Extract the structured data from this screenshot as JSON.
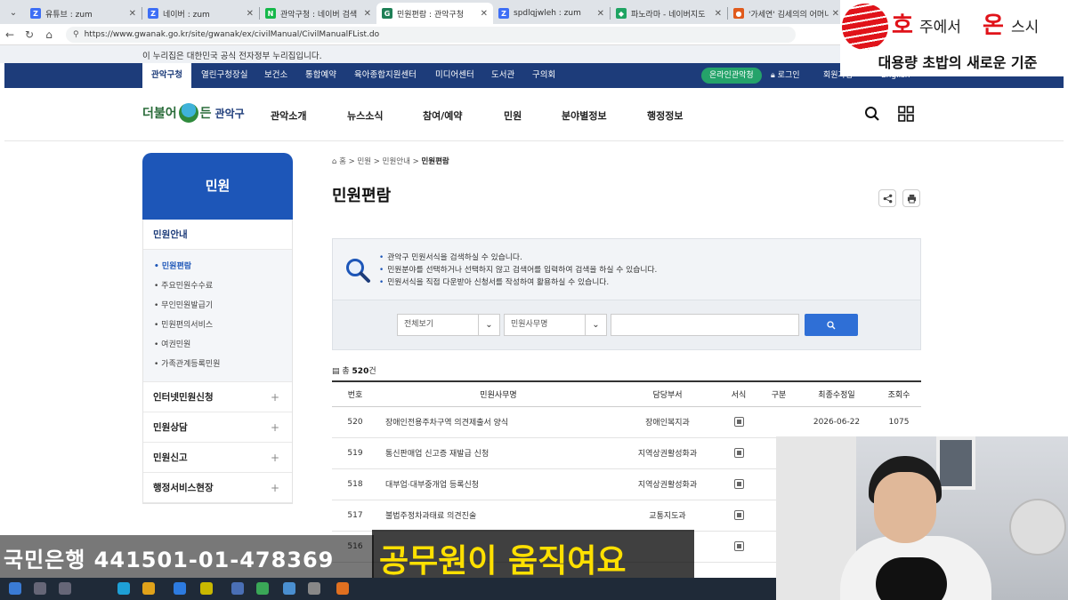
{
  "browser": {
    "tabs": [
      {
        "title": "유튜브 : zum",
        "fav": "Z",
        "color": "#3d6ef5"
      },
      {
        "title": "네이버 : zum",
        "fav": "Z",
        "color": "#3d6ef5"
      },
      {
        "title": "관악구청 : 네이버 검색",
        "fav": "N",
        "color": "#15b84a"
      },
      {
        "title": "민원편람 : 관악구청",
        "fav": "G",
        "color": "#1e7f56"
      },
      {
        "title": "spdlqjwleh : zum",
        "fav": "Z",
        "color": "#3d6ef5"
      },
      {
        "title": "파노라마 - 네이버지도",
        "fav": "◆",
        "color": "#1fa463"
      },
      {
        "title": "'가세연' 김세의의 어머니, 이",
        "fav": "●",
        "color": "#e05a1c"
      }
    ],
    "url": "https://www.gwanak.go.kr/site/gwanak/ex/civilManual/CivilManualFList.do"
  },
  "notice": "이 누리집은 대한민국 공식 전자정부 누리집입니다.",
  "topnav": {
    "items": [
      "관악구청",
      "열린구청장실",
      "보건소",
      "통합예약",
      "육아종합지원센터",
      "미디어센터",
      "도서관",
      "구의회"
    ],
    "online": "온라인관악청",
    "login": "로그인",
    "utility": "회원가입",
    "english": "English"
  },
  "header": {
    "logo": {
      "part1": "더불어",
      "part2": "든",
      "part3": "관악구"
    },
    "menu": [
      "관악소개",
      "뉴스소식",
      "참여/예약",
      "민원",
      "분야별정보",
      "행정정보"
    ]
  },
  "sidebar": {
    "title": "민원",
    "section": "민원안내",
    "subitems": [
      "민원편람",
      "주요민원수수료",
      "무인민원발급기",
      "민원편의서비스",
      "여권민원",
      "가족관계등록민원"
    ],
    "groups": [
      "인터넷민원신청",
      "민원상담",
      "민원신고",
      "행정서비스현장"
    ]
  },
  "breadcrumb": {
    "home": "홈",
    "c1": "민원",
    "c2": "민원안내",
    "c3": "민원편람"
  },
  "page_title": "민원편람",
  "info": [
    "관악구 민원서식을 검색하실 수 있습니다.",
    "민원분야를 선택하거나 선택하지 않고 검색어를 입력하여 검색을 하실 수 있습니다.",
    "민원서식을 직접 다운받아 신청서를 작성하여 활용하실 수 있습니다."
  ],
  "search": {
    "category": "전체보기",
    "field": "민원사무명",
    "query": ""
  },
  "count": {
    "prefix": "총",
    "value": "520",
    "suffix": "건"
  },
  "table": {
    "headers": [
      "번호",
      "민원사무명",
      "담당부서",
      "서식",
      "구분",
      "최종수정일",
      "조회수"
    ],
    "rows": [
      {
        "no": "520",
        "name": "장애인전용주차구역 의견제출서 양식",
        "dept": "장애인복지과",
        "date": "2026-06-22",
        "views": "1075"
      },
      {
        "no": "519",
        "name": "통신판매업 신고증 재발급 신청",
        "dept": "지역상권활성화과",
        "date": "",
        "views": ""
      },
      {
        "no": "518",
        "name": "대부업·대부중개업 등록신청",
        "dept": "지역상권활성화과",
        "date": "",
        "views": ""
      },
      {
        "no": "517",
        "name": "불법주정차과태료 의견진술",
        "dept": "교통지도과",
        "date": "",
        "views": ""
      },
      {
        "no": "516",
        "name": "",
        "dept": "",
        "date": "",
        "views": ""
      }
    ]
  },
  "overlay": {
    "brand": {
      "big1": "호",
      "small1": "주에서",
      "big2": "온",
      "small2": "스시",
      "slogan": "대용량 초밥의 새로운 기준"
    },
    "bank": "국민은행 441501-01-478369",
    "caption": "공무원이 움직여요"
  },
  "colors": {
    "navy": "#1d3c7a",
    "blue": "#1d56b8",
    "green": "#25a36a",
    "caption": "#ffe000",
    "brand_red": "#e0131a"
  }
}
